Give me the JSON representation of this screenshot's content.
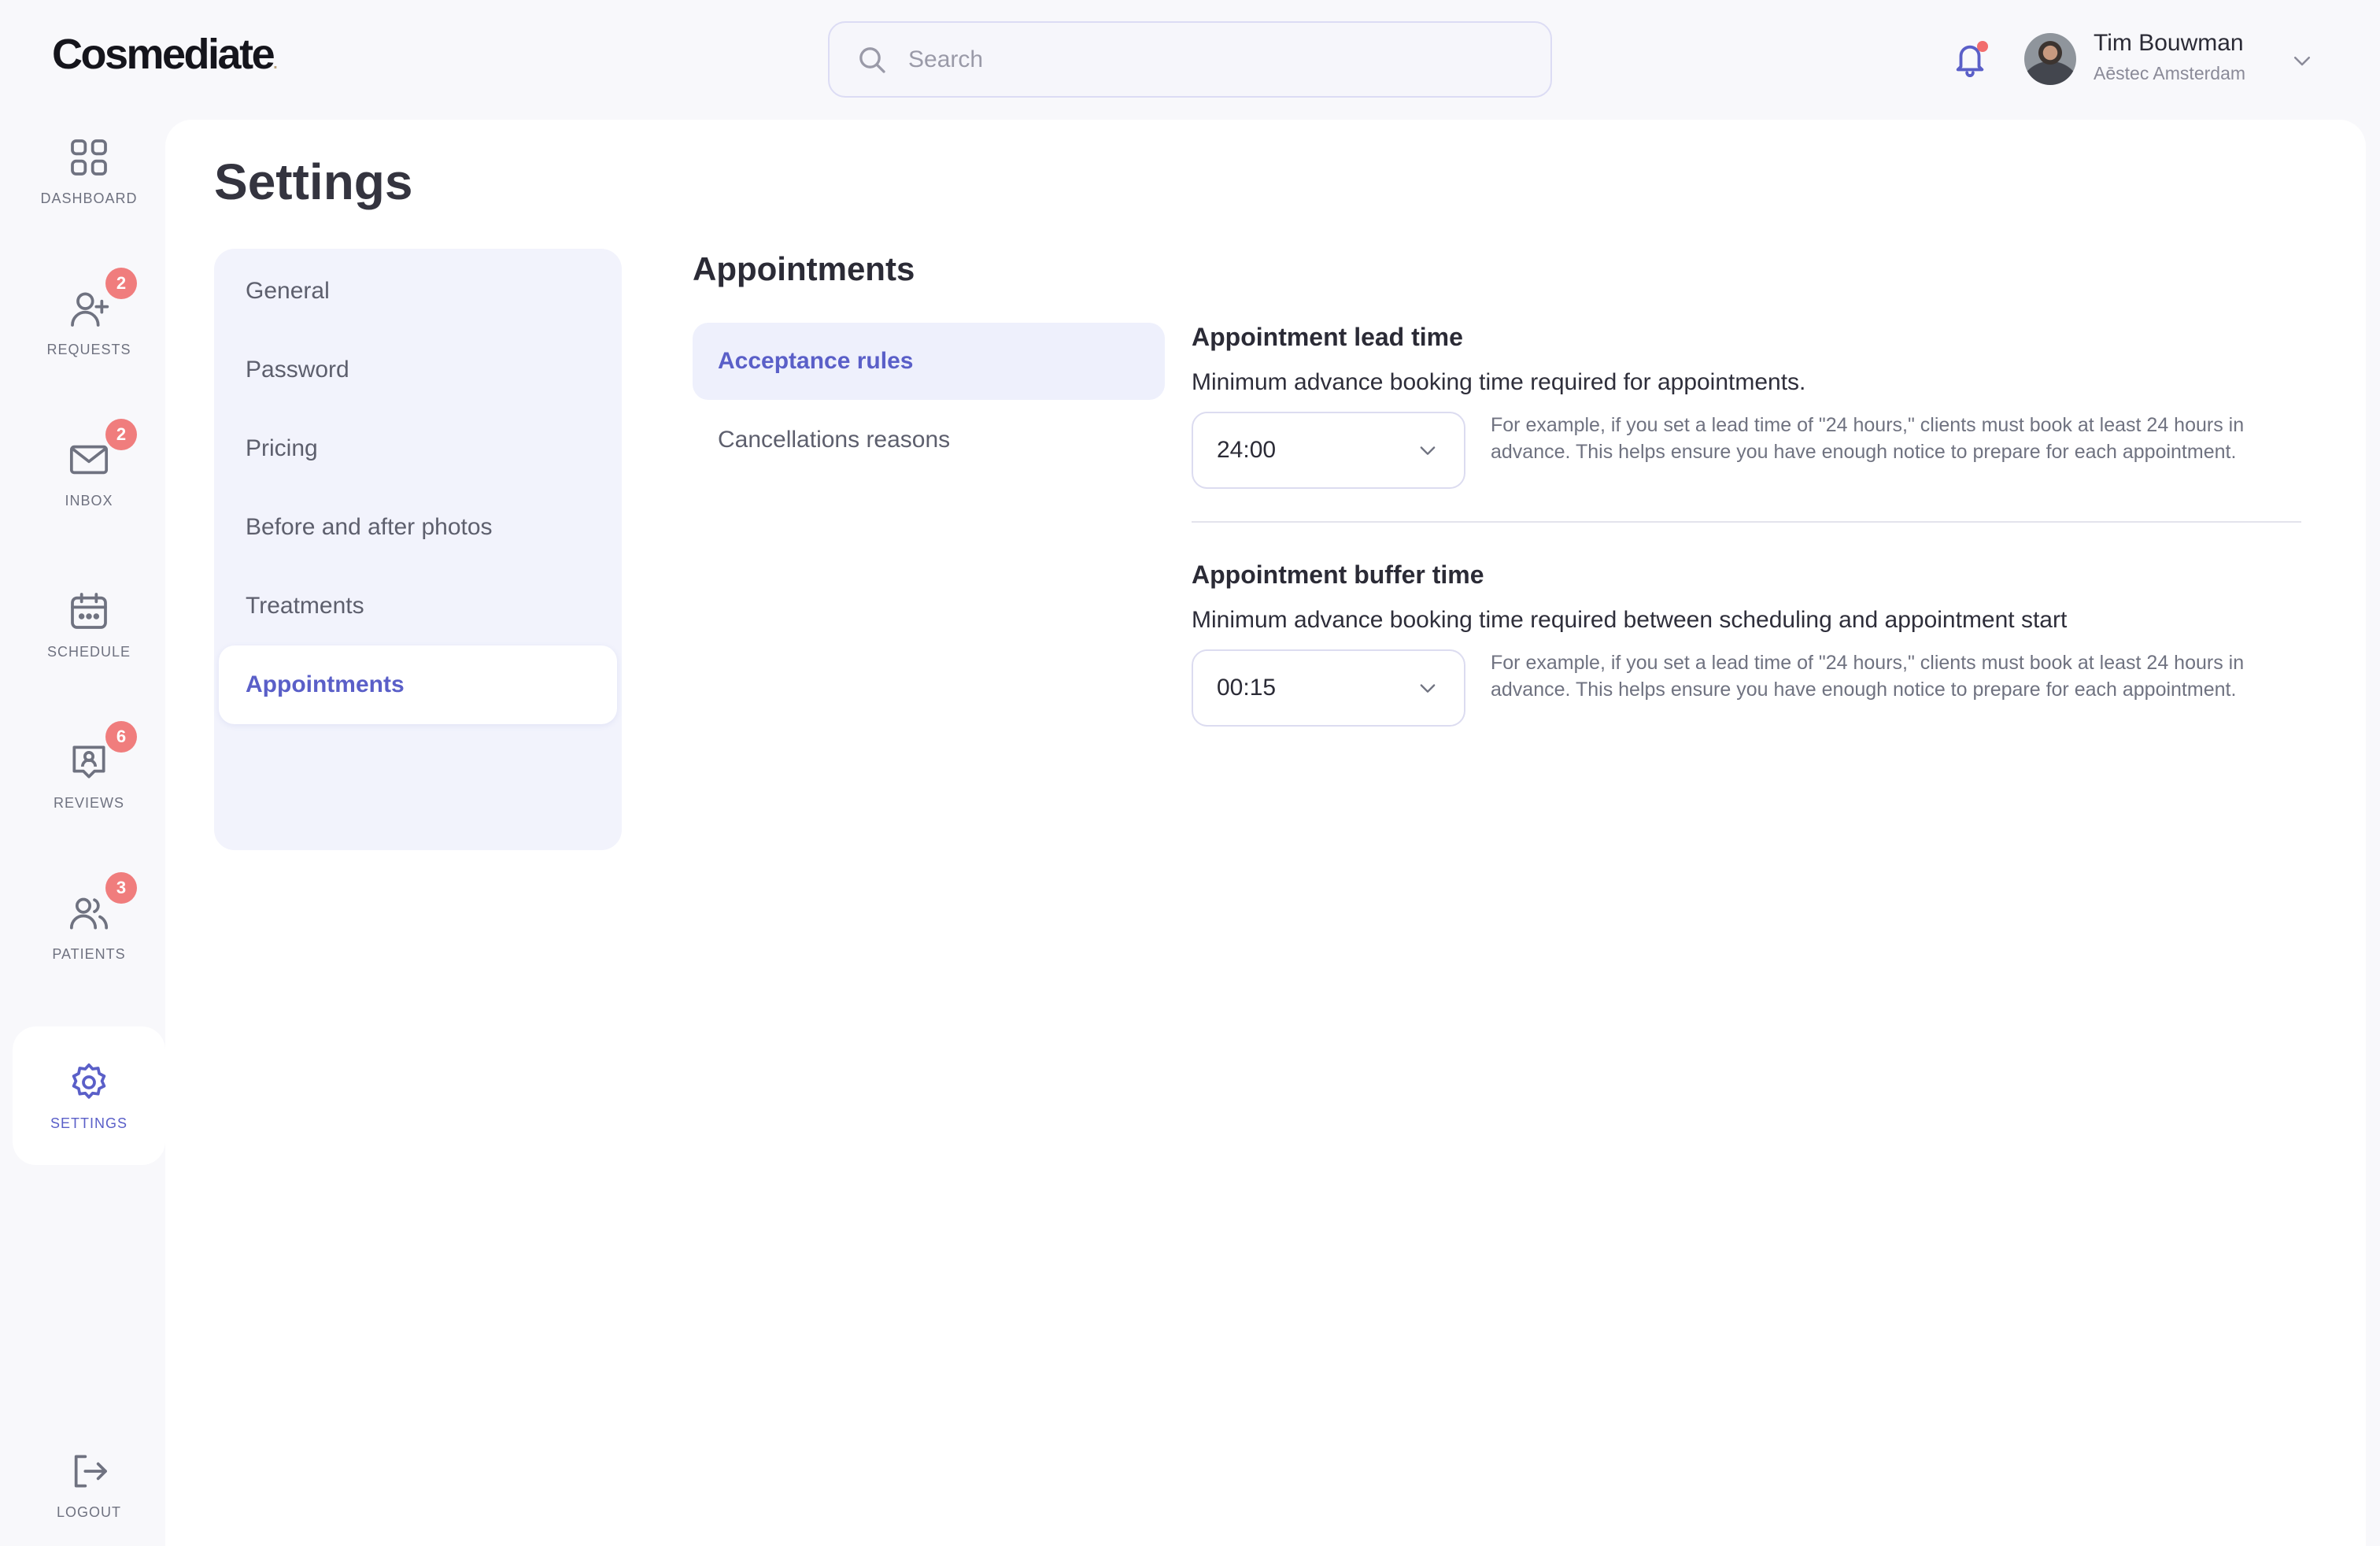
{
  "app": {
    "logo_text": "Cosmediate",
    "logo_mark": "."
  },
  "search": {
    "placeholder": "Search"
  },
  "user": {
    "name": "Tim Bouwman",
    "org": "Aēstec Amsterdam"
  },
  "nav": {
    "dashboard": {
      "label": "DASHBOARD",
      "icon": "grid-icon"
    },
    "requests": {
      "label": "REQUESTS",
      "icon": "user-plus-icon",
      "badge": "2"
    },
    "inbox": {
      "label": "INBOX",
      "icon": "mail-icon",
      "badge": "2"
    },
    "schedule": {
      "label": "SCHEDULE",
      "icon": "calendar-icon"
    },
    "reviews": {
      "label": "REVIEWS",
      "icon": "review-icon",
      "badge": "6"
    },
    "patients": {
      "label": "PATIENTS",
      "icon": "users-icon",
      "badge": "3"
    },
    "settings": {
      "label": "SETTINGS",
      "icon": "gear-icon"
    },
    "logout": {
      "label": "LOGOUT",
      "icon": "logout-icon"
    }
  },
  "page": {
    "title": "Settings"
  },
  "settings_menu": {
    "items": [
      "General",
      "Password",
      "Pricing",
      "Before and after photos",
      "Treatments",
      "Appointments"
    ]
  },
  "section": {
    "title": "Appointments",
    "tabs": [
      "Acceptance rules",
      "Cancellations reasons"
    ]
  },
  "lead_time": {
    "title": "Appointment lead time",
    "description": "Minimum advance booking time required for appointments.",
    "value": "24:00",
    "hint": "For example, if you set a lead time of \"24 hours,\" clients must book at least 24 hours in advance. This helps ensure you have enough notice to prepare for each appointment."
  },
  "buffer_time": {
    "title": "Appointment buffer time",
    "description": "Minimum advance booking time required between scheduling and appointment start",
    "value": "00:15",
    "hint": "For example, if you set a lead time of \"24 hours,\" clients must book at least 24 hours in advance. This helps ensure you have enough notice to prepare for each appointment."
  },
  "colors": {
    "accent": "#5a5fc8",
    "badge": "#f07d7d",
    "background": "#f8f8fb",
    "menu_background": "#f2f3fc"
  }
}
